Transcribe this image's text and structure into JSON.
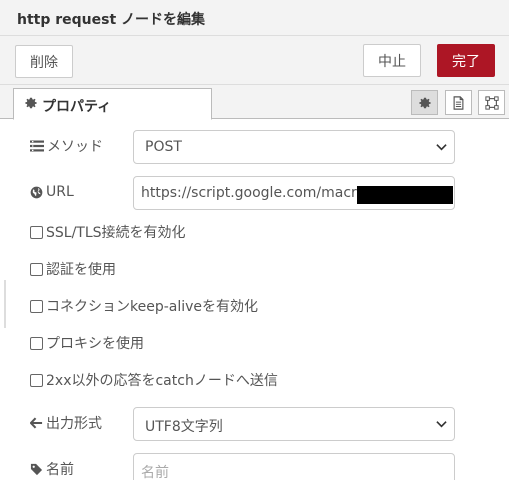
{
  "dialog": {
    "title": "http request ノードを編集"
  },
  "toolbar": {
    "delete_label": "削除",
    "cancel_label": "中止",
    "done_label": "完了"
  },
  "tabs": {
    "properties_label": "プロパティ"
  },
  "form": {
    "method": {
      "label": "メソッド",
      "value": "POST"
    },
    "url": {
      "label": "URL",
      "value": "https://script.google.com/macros/s/"
    },
    "checkboxes": [
      {
        "label": "SSL/TLS接続を有効化",
        "checked": false
      },
      {
        "label": "認証を使用",
        "checked": false
      },
      {
        "label": "コネクションkeep-aliveを有効化",
        "checked": false
      },
      {
        "label": "プロキシを使用",
        "checked": false
      },
      {
        "label": "2xx以外の応答をcatchノードへ送信",
        "checked": false
      }
    ],
    "output": {
      "label": "出力形式",
      "value": "UTF8文字列"
    },
    "name": {
      "label": "名前",
      "placeholder": "名前"
    }
  },
  "colors": {
    "primary": "#ad1625",
    "toolbar_bg": "#f3f3f3",
    "border": "#cccccc"
  },
  "icons": {
    "tab": "gear-icon",
    "method": "list-icon",
    "url": "globe-icon",
    "output": "arrow-left-icon",
    "name": "tag-icon"
  }
}
